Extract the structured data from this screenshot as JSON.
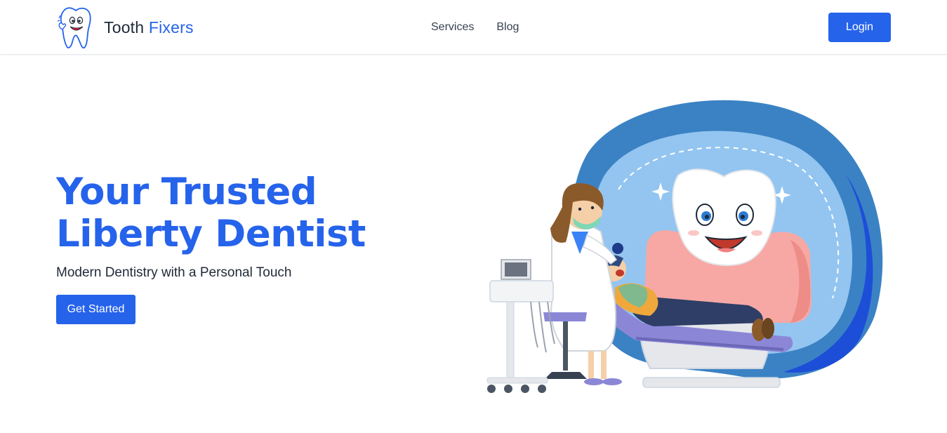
{
  "brand": {
    "name_part1": "Tooth",
    "name_part2": "Fixers",
    "logo_icon": "cartoon-tooth-thumbs-up-icon"
  },
  "nav": {
    "items": [
      {
        "label": "Services"
      },
      {
        "label": "Blog"
      }
    ]
  },
  "header": {
    "login_label": "Login"
  },
  "hero": {
    "title_line1": "Your Trusted",
    "title_line2": "Liberty Dentist",
    "subtitle": "Modern Dentistry with a Personal Touch",
    "cta_label": "Get Started",
    "illustration_icon": "dentist-treating-patient-illustration"
  },
  "colors": {
    "primary": "#2563eb",
    "text_dark": "#1f2937",
    "blob_outer": "#3b82c4",
    "blob_inner": "#93c5f0",
    "gum_pink": "#f7a8a4"
  }
}
